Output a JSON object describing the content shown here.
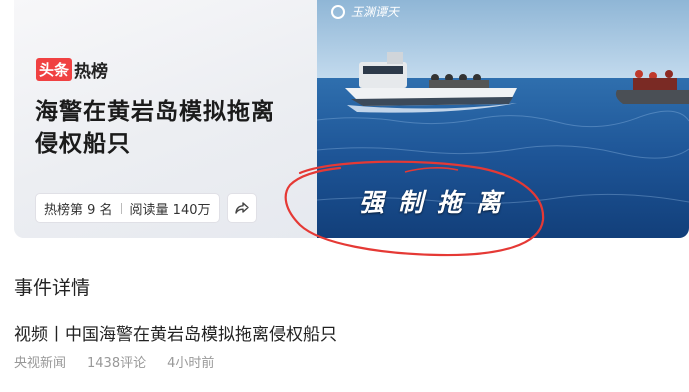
{
  "hot_card": {
    "brand_tag": "头条",
    "brand_hot": "热榜",
    "headline": "海警在黄岩岛模拟拖离侵权船只",
    "rank_text": "热榜第 9 名",
    "read_text": "阅读量 140万",
    "share_icon": "share-icon"
  },
  "video_thumb": {
    "watermark": "玉渊谭天",
    "caption": "强制拖离"
  },
  "annotation": {
    "color": "#e53935",
    "shape": "hand-drawn-ellipse"
  },
  "event_section": {
    "title": "事件详情"
  },
  "article": {
    "title": "视频丨中国海警在黄岩岛模拟拖离侵权船只",
    "source": "央视新闻",
    "comments": "1438评论",
    "time": "4小时前"
  }
}
